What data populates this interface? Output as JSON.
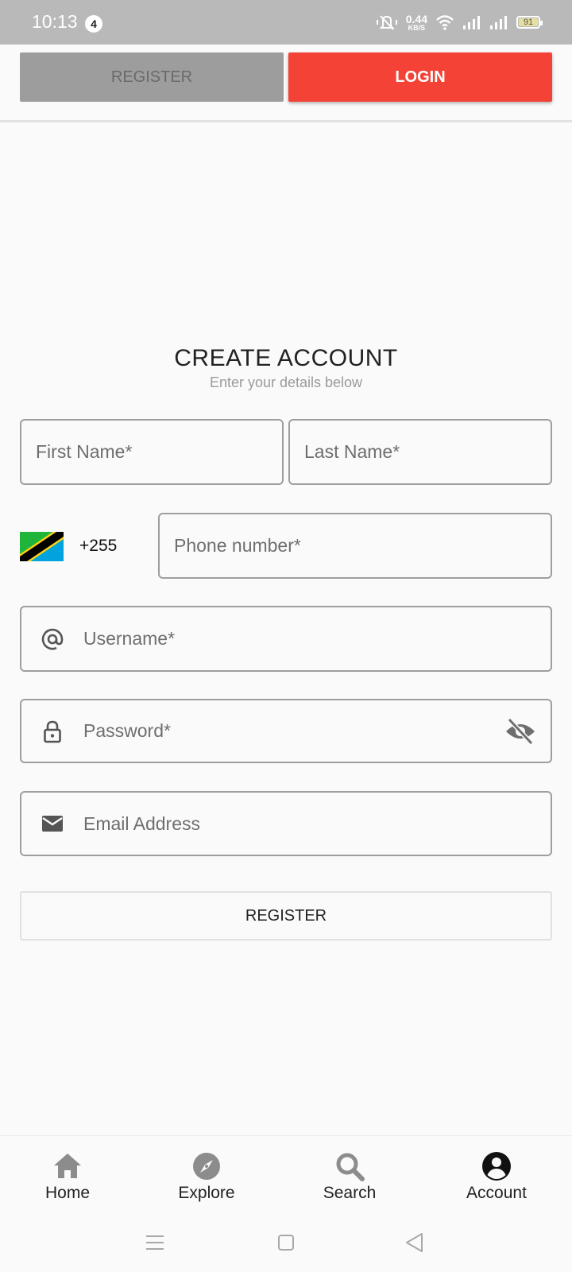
{
  "status_bar": {
    "time": "10:13",
    "notification_count": "4",
    "net_speed_value": "0.44",
    "net_speed_unit": "KB/S",
    "battery_level": "91",
    "battery_fraction": 0.91,
    "icons": [
      "mute-vibrate-icon",
      "wifi-icon",
      "signal-icon",
      "signal-icon",
      "battery-icon"
    ]
  },
  "tabs": {
    "register_label": "REGISTER",
    "login_label": "LOGIN",
    "login_color": "#f44336"
  },
  "form": {
    "title": "CREATE ACCOUNT",
    "subtitle": "Enter your details below",
    "first_name_placeholder": "First Name*",
    "last_name_placeholder": "Last Name*",
    "country_flag": "tanzania-flag-icon",
    "dial_code": "+255",
    "phone_placeholder": "Phone number*",
    "username_placeholder": "Username*",
    "password_placeholder": "Password*",
    "email_placeholder": "Email Address",
    "submit_label": "REGISTER"
  },
  "bottom_nav": {
    "items": [
      {
        "label": "Home",
        "icon": "home-icon"
      },
      {
        "label": "Explore",
        "icon": "compass-icon"
      },
      {
        "label": "Search",
        "icon": "search-icon"
      },
      {
        "label": "Account",
        "icon": "account-circle-icon"
      }
    ],
    "active": "Account"
  },
  "system_nav": {
    "buttons": [
      "menu-icon",
      "home-square-icon",
      "back-triangle-icon"
    ]
  }
}
